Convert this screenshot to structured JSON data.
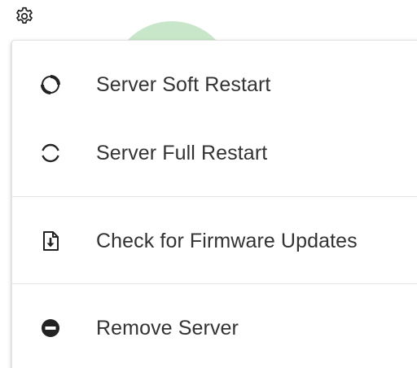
{
  "settings_button": {
    "icon": "gear-icon"
  },
  "menu": {
    "items": [
      {
        "label": "Server Soft Restart",
        "icon": "soft-restart-icon"
      },
      {
        "label": "Server Full Restart",
        "icon": "full-restart-icon"
      },
      {
        "label": "Check for Firmware Updates",
        "icon": "firmware-download-icon"
      },
      {
        "label": "Remove Server",
        "icon": "remove-icon"
      }
    ]
  },
  "colors": {
    "text": "#333333",
    "icon": "#222222",
    "accent_circle": "#c8e6c9",
    "divider": "#e4e4e4"
  }
}
